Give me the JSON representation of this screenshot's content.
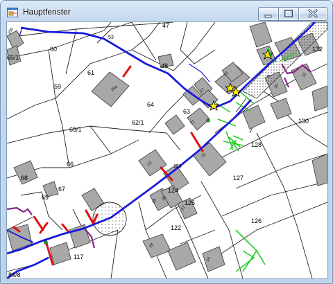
{
  "window": {
    "title": "Hauptfenster",
    "icons": {
      "app": "map-window-icon",
      "minimize": "minimize-icon",
      "maximize": "maximize-icon",
      "close": "close-icon"
    }
  },
  "map": {
    "parcel_numbers": [
      "47",
      "53",
      "60",
      "65/1",
      "61",
      "48",
      "59",
      "64",
      "62/1",
      "63",
      "65/1",
      "66",
      "68",
      "67",
      "69",
      "124",
      "123",
      "125",
      "122",
      "117",
      "89/8",
      "128",
      "127",
      "126",
      "130",
      "132"
    ],
    "house_numbers": [
      "25b",
      "29a",
      "17",
      "19",
      "21",
      "23",
      "25",
      "18",
      "20",
      "27",
      "28",
      "8",
      "10",
      "12",
      "14"
    ],
    "line_colors": {
      "main_pipe": "#1a1adb",
      "service_red": "#e01010",
      "service_green": "#22cc22",
      "service_purple": "#882288",
      "building": "#a8a8a8"
    }
  }
}
